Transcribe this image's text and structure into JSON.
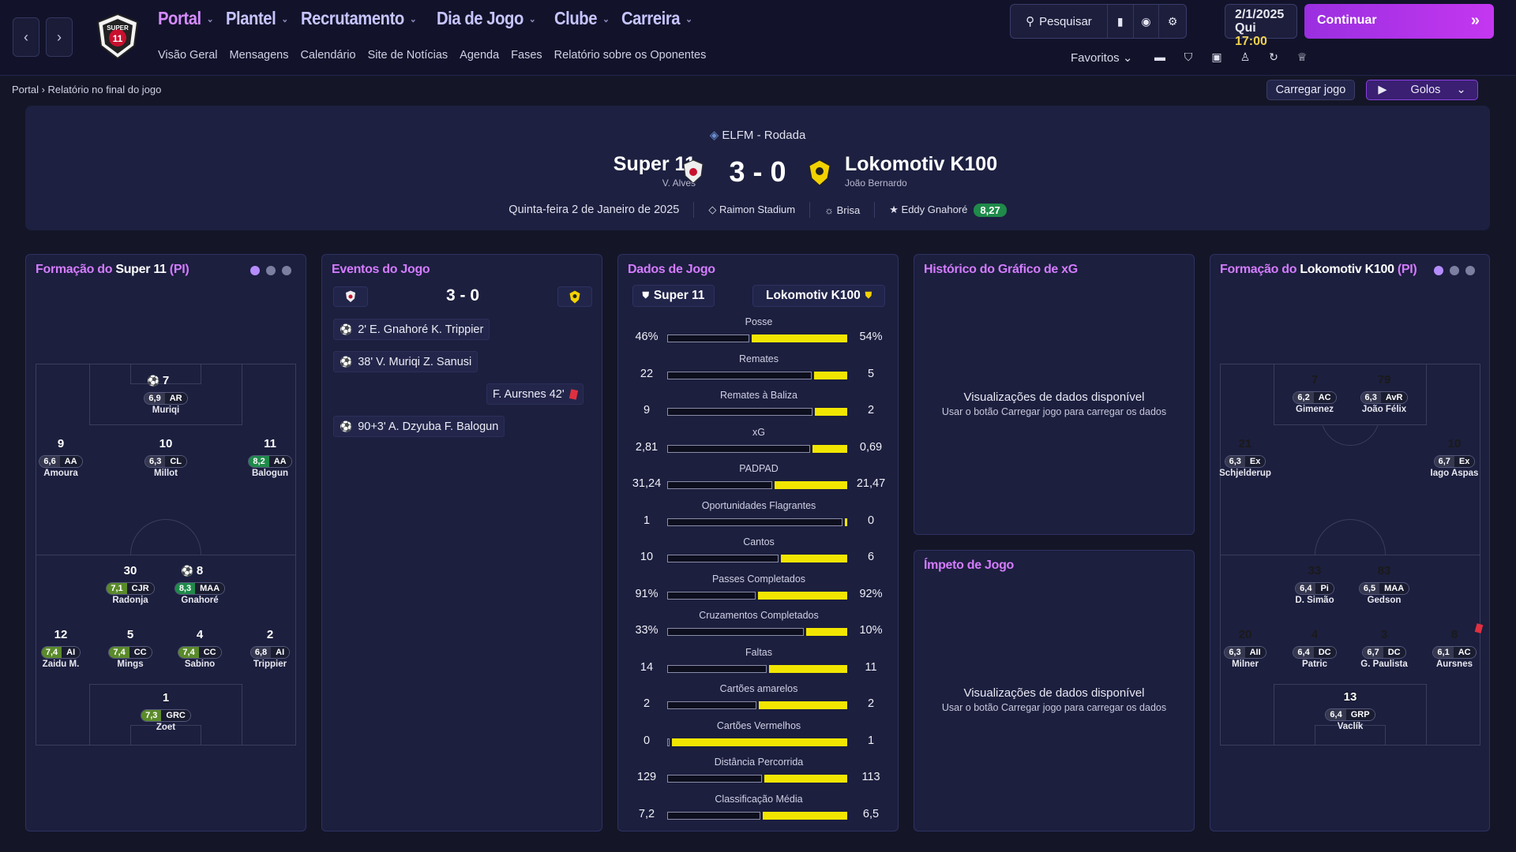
{
  "nav": {
    "menu": [
      {
        "label": "Portal",
        "active": true
      },
      {
        "label": "Plantel",
        "active": false
      },
      {
        "label": "Recrutamento",
        "active": false
      },
      {
        "label": "Dia de Jogo",
        "active": false
      },
      {
        "label": "Clube",
        "active": false
      },
      {
        "label": "Carreira",
        "active": false
      }
    ],
    "submenu": [
      "Visão Geral",
      "Mensagens",
      "Calendário",
      "Site de Notícias",
      "Agenda",
      "Fases",
      "Relatório sobre os Oponentes"
    ],
    "search_label": "Pesquisar",
    "date": "2/1/2025",
    "weekday": "Qui",
    "time": "17:00",
    "continue_label": "Continuar",
    "favorites_label": "Favoritos"
  },
  "breadcrumb": {
    "root": "Portal",
    "current": "Relatório no final do jogo"
  },
  "actions": {
    "load_match": "Carregar jogo",
    "golos": "Golos"
  },
  "header": {
    "competition": "ELFM - Rodada",
    "home_team": "Super 11",
    "home_manager": "V. Alves",
    "away_team": "Lokomotiv K100",
    "away_manager": "João Bernardo",
    "score": "3 - 0",
    "date": "Quinta-feira 2 de Janeiro de 2025",
    "stadium": "Raimon Stadium",
    "weather": "Brisa",
    "motm": "Eddy Gnahoré",
    "motm_rating": "8,27"
  },
  "home_formation": {
    "title_prefix": "Formação do",
    "team": "Super 11",
    "suffix": "(PI)",
    "players": [
      {
        "num": "7",
        "rating": "6,9",
        "pos": "AR",
        "name": "Muriqi",
        "goal": true,
        "tier": "n"
      },
      {
        "num": "9",
        "rating": "6,6",
        "pos": "AA",
        "name": "Amoura",
        "tier": "n"
      },
      {
        "num": "10",
        "rating": "6,3",
        "pos": "CL",
        "name": "Millot",
        "tier": "n"
      },
      {
        "num": "11",
        "rating": "8,2",
        "pos": "AA",
        "name": "Balogun",
        "tier": "g"
      },
      {
        "num": "30",
        "rating": "7,1",
        "pos": "CJR",
        "name": "Radonja",
        "tier": "m"
      },
      {
        "num": "8",
        "rating": "8,3",
        "pos": "MAA",
        "name": "Gnahoré",
        "goal": true,
        "tier": "g"
      },
      {
        "num": "12",
        "rating": "7,4",
        "pos": "AI",
        "name": "Zaidu M.",
        "tier": "m"
      },
      {
        "num": "5",
        "rating": "7,4",
        "pos": "CC",
        "name": "Mings",
        "tier": "m"
      },
      {
        "num": "4",
        "rating": "7,4",
        "pos": "CC",
        "name": "Sabino",
        "tier": "m"
      },
      {
        "num": "2",
        "rating": "6,8",
        "pos": "AI",
        "name": "Trippier",
        "tier": "n"
      },
      {
        "num": "1",
        "rating": "7,3",
        "pos": "GRC",
        "name": "Zoet",
        "tier": "m",
        "gk": true
      }
    ]
  },
  "events": {
    "title": "Eventos do Jogo",
    "score": "3 - 0",
    "items": [
      {
        "text": "2'  E. Gnahoré  K. Trippier",
        "type": "goal",
        "side": "home"
      },
      {
        "text": "38'  V. Muriqi  Z. Sanusi",
        "type": "goal",
        "side": "home"
      },
      {
        "text": "F. Aursnes  42'",
        "type": "red",
        "side": "away"
      },
      {
        "text": "90+3'  A. Dzyuba  F. Balogun",
        "type": "goal",
        "side": "home"
      }
    ]
  },
  "stats": {
    "title": "Dados de Jogo",
    "home_tab": "Super 11",
    "away_tab": "Lokomotiv K100",
    "rows": [
      {
        "label": "Posse",
        "home": "46%",
        "away": "54%",
        "h": 46,
        "a": 54
      },
      {
        "label": "Remates",
        "home": "22",
        "away": "5",
        "h": 22,
        "a": 5
      },
      {
        "label": "Remates à Baliza",
        "home": "9",
        "away": "2",
        "h": 9,
        "a": 2
      },
      {
        "label": "xG",
        "home": "2,81",
        "away": "0,69",
        "h": 2.81,
        "a": 0.69
      },
      {
        "label": "PADPAD",
        "home": "31,24",
        "away": "21,47",
        "h": 31.24,
        "a": 21.47
      },
      {
        "label": "Oportunidades Flagrantes",
        "home": "1",
        "away": "0",
        "h": 1,
        "a": 0
      },
      {
        "label": "Cantos",
        "home": "10",
        "away": "6",
        "h": 10,
        "a": 6
      },
      {
        "label": "Passes Completados",
        "home": "91%",
        "away": "92%",
        "h": 91,
        "a": 92
      },
      {
        "label": "Cruzamentos Completados",
        "home": "33%",
        "away": "10%",
        "h": 33,
        "a": 10
      },
      {
        "label": "Faltas",
        "home": "14",
        "away": "11",
        "h": 14,
        "a": 11
      },
      {
        "label": "Cartões amarelos",
        "home": "2",
        "away": "2",
        "h": 2,
        "a": 2
      },
      {
        "label": "Cartões Vermelhos",
        "home": "0",
        "away": "1",
        "h": 0,
        "a": 1
      },
      {
        "label": "Distância Percorrida",
        "home": "129",
        "away": "113",
        "h": 129,
        "a": 113
      },
      {
        "label": "Classificação Média",
        "home": "7,2",
        "away": "6,5",
        "h": 7.2,
        "a": 6.5
      }
    ]
  },
  "xg_panel": {
    "title": "Histórico do Gráfico de xG",
    "msg1": "Visualizações de dados disponível",
    "msg2": "Usar o botão Carregar jogo para carregar os dados"
  },
  "momentum_panel": {
    "title": "Ímpeto de Jogo",
    "msg1": "Visualizações de dados disponível",
    "msg2": "Usar o botão Carregar jogo para carregar os dados"
  },
  "away_formation": {
    "title_prefix": "Formação do",
    "team": "Lokomotiv K100",
    "suffix": "(PI)",
    "players": [
      {
        "num": "7",
        "rating": "6,2",
        "pos": "AC",
        "name": "Gimenez",
        "tier": "n"
      },
      {
        "num": "79",
        "rating": "6,3",
        "pos": "AvR",
        "name": "João Félix",
        "tier": "n"
      },
      {
        "num": "21",
        "rating": "6,3",
        "pos": "Ex",
        "name": "Schjelderup",
        "tier": "n"
      },
      {
        "num": "10",
        "rating": "6,7",
        "pos": "Ex",
        "name": "Iago Aspas",
        "tier": "n"
      },
      {
        "num": "33",
        "rating": "6,4",
        "pos": "Pi",
        "name": "D. Simão",
        "tier": "n"
      },
      {
        "num": "83",
        "rating": "6,5",
        "pos": "MAA",
        "name": "Gedson",
        "tier": "n"
      },
      {
        "num": "20",
        "rating": "6,3",
        "pos": "AII",
        "name": "Milner",
        "tier": "n"
      },
      {
        "num": "4",
        "rating": "6,4",
        "pos": "DC",
        "name": "Patric",
        "tier": "n"
      },
      {
        "num": "3",
        "rating": "6,7",
        "pos": "DC",
        "name": "G. Paulista",
        "tier": "n"
      },
      {
        "num": "8",
        "rating": "6,1",
        "pos": "AC",
        "name": "Aursnes",
        "tier": "n",
        "red": true
      },
      {
        "num": "13",
        "rating": "6,4",
        "pos": "GRP",
        "name": "Vaclík",
        "tier": "n",
        "gk": true
      }
    ]
  }
}
